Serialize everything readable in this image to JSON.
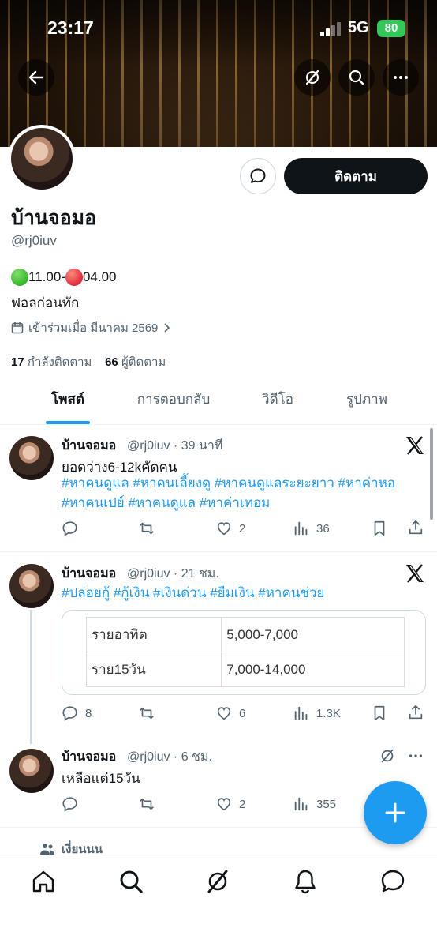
{
  "status": {
    "time": "23:17",
    "network": "5G",
    "battery": "80"
  },
  "header_icons": [
    "back-arrow-icon",
    "grok-icon",
    "search-icon",
    "more-icon"
  ],
  "profile": {
    "display_name": "บ้านจอมอ",
    "handle": "@rj0iuv",
    "follow_label": "ติดตาม",
    "bio_hours_open": "11.00-",
    "bio_hours_close": "04.00",
    "bio_line2": "ฟอลก่อนทัก",
    "joined": "เข้าร่วมเมื่อ มีนาคม 2569",
    "following_count": "17",
    "following_label": "กำลังติดตาม",
    "followers_count": "66",
    "followers_label": "ผู้ติดตาม"
  },
  "tabs": [
    "โพสต์",
    "การตอบกลับ",
    "วิดีโอ",
    "รูปภาพ"
  ],
  "tweets": [
    {
      "name": "บ้านจอมอ",
      "meta": "@rj0iuv · 39 นาที",
      "text": "ยอดว่าง6-12kคัดคน",
      "tags_line1": "#หาคนดูแล #หาคนเลี้ยงดู #หาคนดูแลระยะยาว #หาค่าหอ",
      "tags_line2": "#หาคนเปย์ #หาคนดูแล #หาค่าเทอม",
      "replies": "",
      "likes": "2",
      "views": "36"
    },
    {
      "name": "บ้านจอมอ",
      "meta": "@rj0iuv · 21 ชม.",
      "tags_line1": "#ปล่อยกู้ #กู้เงิน #เงินด่วน #ยืมเงิน #หาคนช่วย",
      "table": [
        [
          "รายอาทิต",
          "5,000-7,000"
        ],
        [
          "ราย15วัน",
          "7,000-14,000"
        ]
      ],
      "replies": "8",
      "likes": "6",
      "views": "1.3K"
    },
    {
      "name": "บ้านจอมอ",
      "meta": "@rj0iuv · 6 ชม.",
      "text": "เหลือแต่15วัน",
      "replies": "",
      "likes": "2",
      "views": "355"
    }
  ],
  "social_context": "เงี่ยนนน",
  "bottom_nav": [
    "home-icon",
    "search-icon",
    "grok-icon",
    "notifications-icon",
    "messages-icon"
  ],
  "colors": {
    "accent": "#1d9bf0",
    "text": "#0f1419",
    "secondary": "#536471"
  }
}
